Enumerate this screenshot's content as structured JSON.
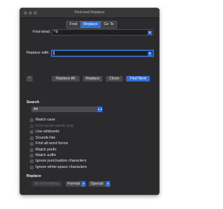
{
  "window": {
    "title": "Find and Replace"
  },
  "tabs": [
    {
      "label": "Find",
      "active": false
    },
    {
      "label": "Replace",
      "active": true
    },
    {
      "label": "Go To",
      "active": false
    }
  ],
  "find": {
    "label": "Find what:",
    "value": "^d"
  },
  "replace": {
    "label": "Replace with:",
    "value": ""
  },
  "actions": {
    "expand_glyph": "⌃",
    "replace_all": "Replace All",
    "replace": "Replace",
    "close": "Close",
    "find_next": "Find Next"
  },
  "search": {
    "heading": "Search",
    "scope": "All",
    "options": [
      {
        "label": "Match case",
        "enabled": true
      },
      {
        "label": "Find whole words only",
        "enabled": false
      },
      {
        "label": "Use wildcards",
        "enabled": true
      },
      {
        "label": "Sounds like",
        "enabled": true
      },
      {
        "label": "Find all word forms",
        "enabled": true
      },
      {
        "label": "Match prefix",
        "enabled": true
      },
      {
        "label": "Match suffix",
        "enabled": true
      },
      {
        "label": "Ignore punctuation characters",
        "enabled": true
      },
      {
        "label": "Ignore white-space characters",
        "enabled": true
      }
    ]
  },
  "replace_section": {
    "heading": "Replace",
    "no_formatting": "No Formatting",
    "format": "Format",
    "special": "Special"
  },
  "colors": {
    "accent": "#2f6fd6",
    "window_bg": "#2b2b2d",
    "button_bg": "#4a4a4d"
  }
}
